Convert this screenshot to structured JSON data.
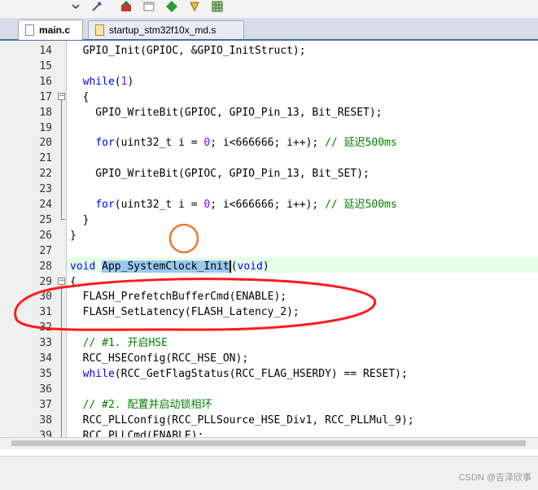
{
  "toolbar": {
    "icons": [
      "dropdown-arrow-icon",
      "build-tools-icon",
      "load-icon",
      "window-icon",
      "diamond-icon",
      "debug-icon",
      "grid-icon"
    ]
  },
  "tabs": [
    {
      "label": "main.c",
      "active": true
    },
    {
      "label": "startup_stm32f10x_md.s",
      "active": false
    }
  ],
  "editor": {
    "lines": [
      {
        "num": "14",
        "text": "  GPIO_Init(GPIOC, &GPIO_InitStruct);"
      },
      {
        "num": "15",
        "text": ""
      },
      {
        "num": "16",
        "text": "  while(1)"
      },
      {
        "num": "17",
        "text": "  {"
      },
      {
        "num": "18",
        "text": "    GPIO_WriteBit(GPIOC, GPIO_Pin_13, Bit_RESET);"
      },
      {
        "num": "19",
        "text": ""
      },
      {
        "num": "20",
        "text": "    for(uint32_t i = 0; i<666666; i++); // 延迟500ms"
      },
      {
        "num": "21",
        "text": ""
      },
      {
        "num": "22",
        "text": "    GPIO_WriteBit(GPIOC, GPIO_Pin_13, Bit_SET);"
      },
      {
        "num": "23",
        "text": ""
      },
      {
        "num": "24",
        "text": "    for(uint32_t i = 0; i<666666; i++); // 延迟500ms"
      },
      {
        "num": "25",
        "text": "  }"
      },
      {
        "num": "26",
        "text": "}"
      },
      {
        "num": "27",
        "text": ""
      },
      {
        "num": "28",
        "text": "void App_SystemClock_Init(void)"
      },
      {
        "num": "29",
        "text": "{"
      },
      {
        "num": "30",
        "text": "  FLASH_PrefetchBufferCmd(ENABLE);"
      },
      {
        "num": "31",
        "text": "  FLASH_SetLatency(FLASH_Latency_2);"
      },
      {
        "num": "32",
        "text": ""
      },
      {
        "num": "33",
        "text": "  // #1. 开启HSE"
      },
      {
        "num": "34",
        "text": "  RCC_HSEConfig(RCC_HSE_ON);"
      },
      {
        "num": "35",
        "text": "  while(RCC_GetFlagStatus(RCC_FLAG_HSERDY) == RESET);"
      },
      {
        "num": "36",
        "text": ""
      },
      {
        "num": "37",
        "text": "  // #2. 配置并启动锁相环"
      },
      {
        "num": "38",
        "text": "  RCC_PLLConfig(RCC_PLLSource_HSE_Div1, RCC_PLLMul_9);"
      },
      {
        "num": "39",
        "text": "  RCC_PLLCmd(ENABLE);"
      }
    ]
  },
  "colors": {
    "keyword": "#0000ff",
    "number": "#8000ff",
    "comment": "#008000",
    "current_line": "#e6ffe6",
    "selection": "#99c9ef",
    "annotation_circle": "#e8782e",
    "annotation_ellipse": "#ff0000"
  },
  "watermark": "CSDN @吉泽欣事"
}
